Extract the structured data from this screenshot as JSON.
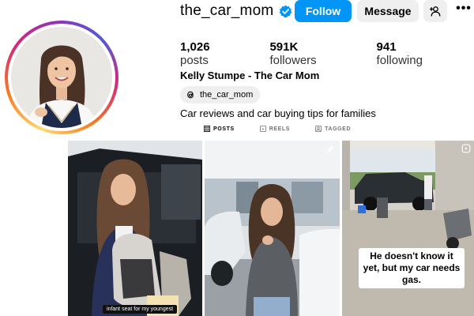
{
  "profile": {
    "username": "the_car_mom",
    "full_name": "Kelly Stumpe - The Car Mom",
    "threads_handle": "the_car_mom",
    "bio": "Car reviews and car buying tips for families"
  },
  "actions": {
    "follow_label": "Follow",
    "message_label": "Message",
    "more_label": "•••"
  },
  "stats": {
    "posts_count": "1,026",
    "posts_label": "posts",
    "followers_count": "591K",
    "followers_label": "followers",
    "following_count": "941",
    "following_label": "following"
  },
  "tabs": {
    "posts": "POSTS",
    "reels": "REELS",
    "tagged": "TAGGED"
  },
  "grid": {
    "post1_caption": "infant seat for my youngest",
    "post3_caption": "He doesn't know it yet, but my car needs gas."
  },
  "colors": {
    "follow_button": "#0095f6",
    "verified_badge": "#0095f6",
    "secondary_button": "#efefef"
  },
  "icons": {
    "verified": "verified-badge-icon",
    "add_user": "add-user-icon",
    "threads": "threads-icon",
    "posts_tab": "grid-icon",
    "reels_tab": "reels-icon",
    "tagged_tab": "tagged-icon",
    "pinned": "pin-icon",
    "reel": "reel-icon"
  }
}
